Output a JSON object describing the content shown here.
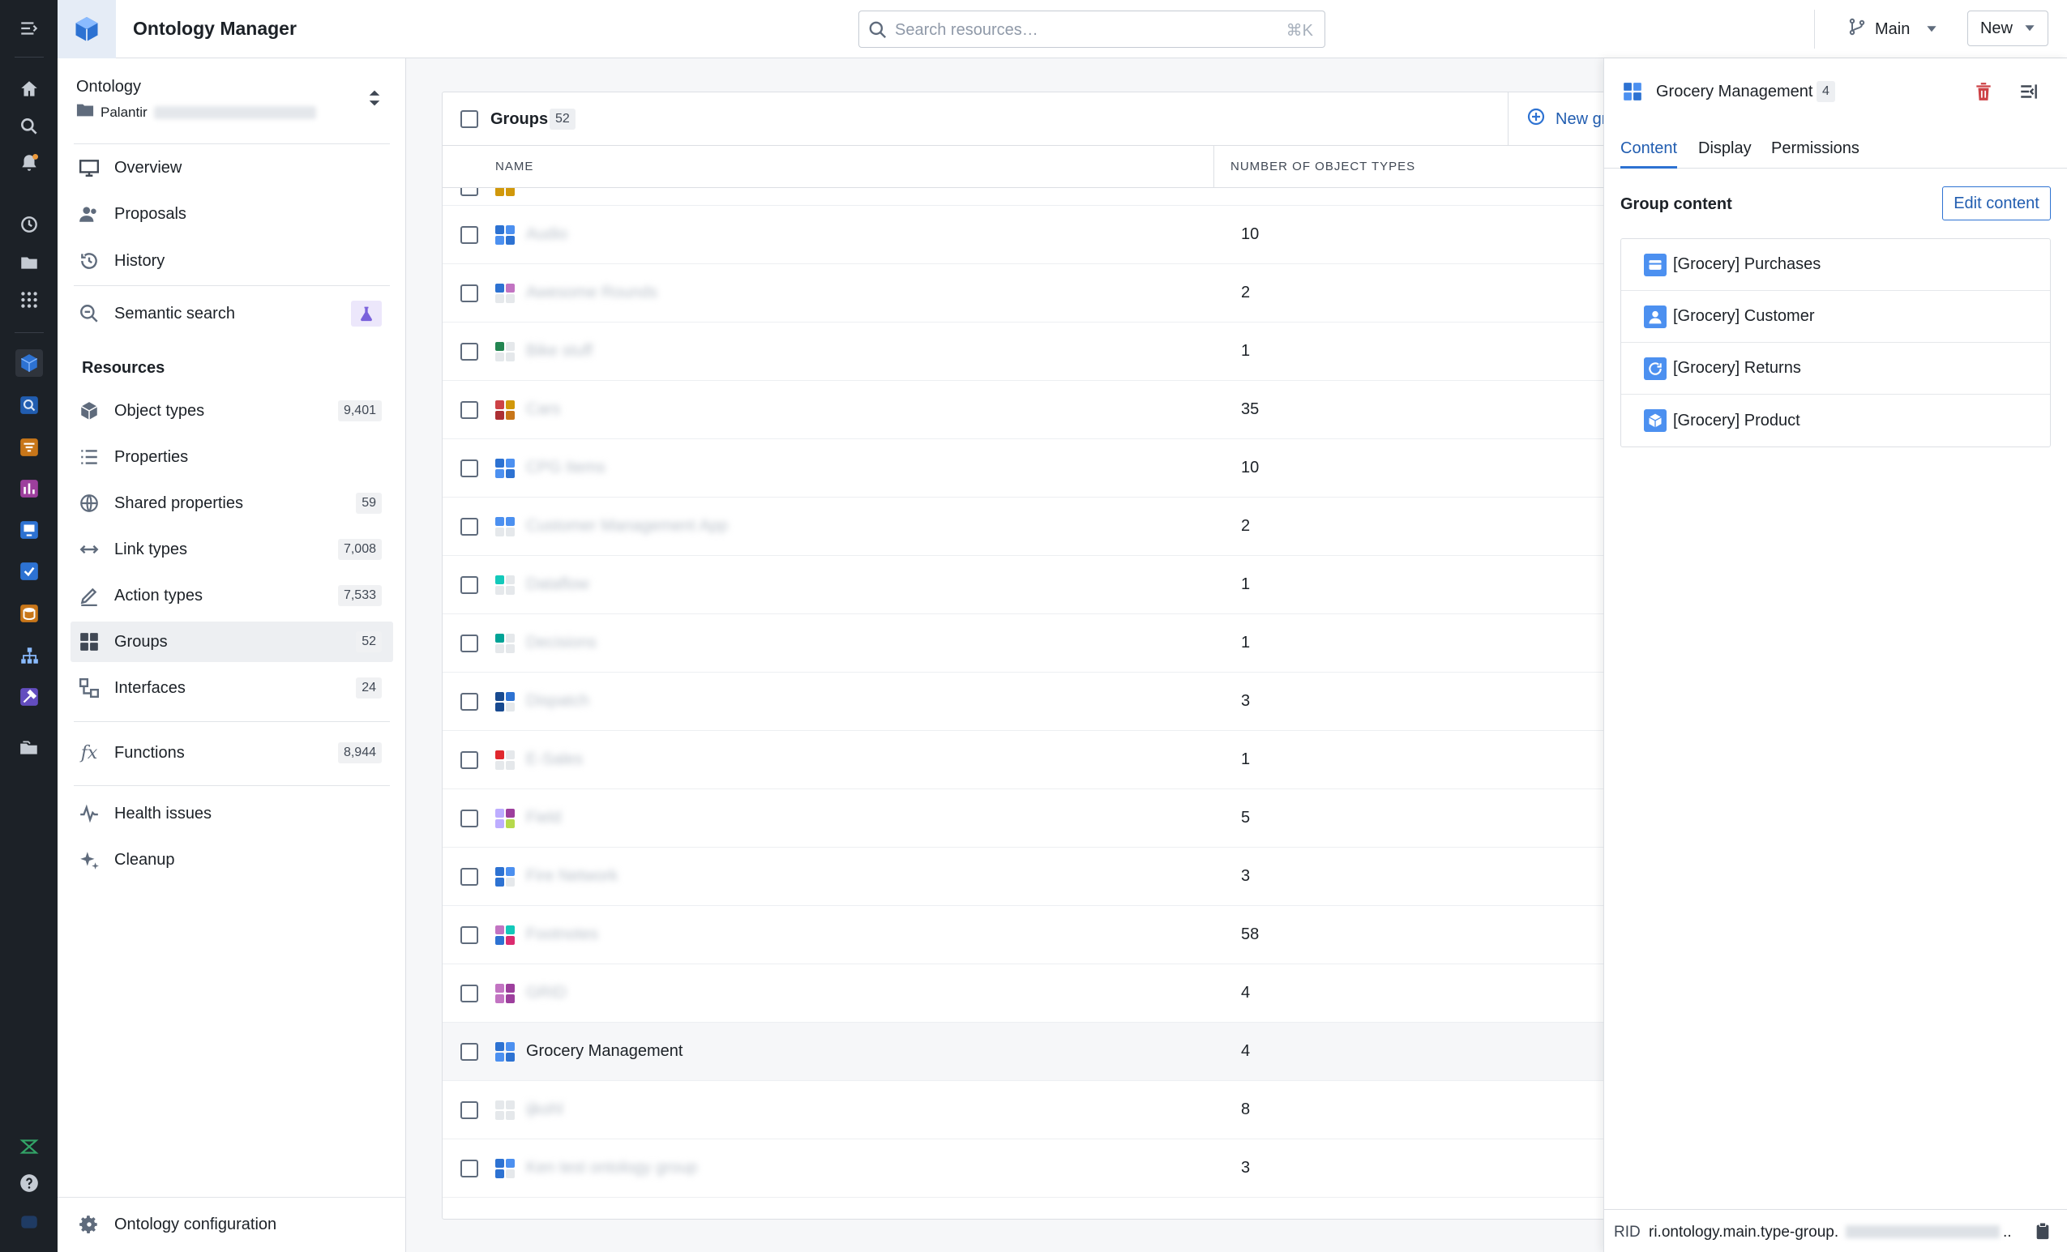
{
  "app": {
    "title": "Ontology Manager",
    "accent_color": "#2d72d2"
  },
  "search": {
    "placeholder": "Search resources…",
    "shortcut": "⌘K"
  },
  "header": {
    "branch_label": "Main",
    "new_label": "New"
  },
  "sidebar": {
    "ontology_label": "Ontology",
    "ontology_name": "Palantir",
    "nav_top": [
      {
        "label": "Overview",
        "icon": "monitor-icon"
      },
      {
        "label": "Proposals",
        "icon": "people-icon"
      },
      {
        "label": "History",
        "icon": "history-icon"
      }
    ],
    "semantic_search": {
      "label": "Semantic search",
      "icon": "search-icon",
      "badge_icon": "flask-icon"
    },
    "resources_heading": "Resources",
    "resources": [
      {
        "label": "Object types",
        "count": "9,401",
        "icon": "cube-icon"
      },
      {
        "label": "Properties",
        "count": "",
        "icon": "list-icon"
      },
      {
        "label": "Shared properties",
        "count": "59",
        "icon": "globe-icon"
      },
      {
        "label": "Link types",
        "count": "7,008",
        "icon": "arrows-icon"
      },
      {
        "label": "Action types",
        "count": "7,533",
        "icon": "edit-icon"
      },
      {
        "label": "Groups",
        "count": "52",
        "icon": "grid-icon"
      },
      {
        "label": "Interfaces",
        "count": "24",
        "icon": "interface-icon"
      }
    ],
    "functions": {
      "label": "Functions",
      "count": "8,944",
      "icon": "function-icon"
    },
    "extras": [
      {
        "label": "Health issues",
        "icon": "pulse-icon"
      },
      {
        "label": "Cleanup",
        "icon": "sparkle-icon"
      }
    ],
    "config_label": "Ontology configuration"
  },
  "table": {
    "title": "Groups",
    "count": "52",
    "new_group_label": "New gr",
    "columns": [
      "NAME",
      "NUMBER OF OBJECT TYPES"
    ],
    "rows": [
      {
        "name": "Audio",
        "count": "10",
        "colors": [
          "#2d72d2",
          "#4c90f0",
          "#4c90f0",
          "#2d72d2"
        ],
        "blurred": true
      },
      {
        "name": "Awesome Rounds",
        "count": "2",
        "colors": [
          "#2d72d2",
          "#c274c2",
          "#e5e8eb",
          "#e5e8eb"
        ],
        "blurred": true
      },
      {
        "name": "Bike stuff",
        "count": "1",
        "colors": [
          "#238551",
          "#e5e8eb",
          "#e5e8eb",
          "#e5e8eb"
        ],
        "blurred": true
      },
      {
        "name": "Cars",
        "count": "35",
        "colors": [
          "#cd4246",
          "#d1980b",
          "#ac2f33",
          "#c87619"
        ],
        "blurred": true
      },
      {
        "name": "CPG Items",
        "count": "10",
        "colors": [
          "#2d72d2",
          "#4c90f0",
          "#4c90f0",
          "#2d72d2"
        ],
        "blurred": true
      },
      {
        "name": "Customer Management App",
        "count": "2",
        "colors": [
          "#4c90f0",
          "#4c90f0",
          "#e5e8eb",
          "#e5e8eb"
        ],
        "blurred": true
      },
      {
        "name": "Dataflow",
        "count": "1",
        "colors": [
          "#13c9ba",
          "#e5e8eb",
          "#e5e8eb",
          "#e5e8eb"
        ],
        "blurred": true
      },
      {
        "name": "Decisions",
        "count": "1",
        "colors": [
          "#00a396",
          "#e5e8eb",
          "#e5e8eb",
          "#e5e8eb"
        ],
        "blurred": true
      },
      {
        "name": "Dispatch",
        "count": "3",
        "colors": [
          "#184a90",
          "#2d72d2",
          "#184a90",
          "#e5e8eb"
        ],
        "blurred": true
      },
      {
        "name": "E-Sales",
        "count": "1",
        "colors": [
          "#e0282e",
          "#e5e8eb",
          "#e5e8eb",
          "#e5e8eb"
        ],
        "blurred": true
      },
      {
        "name": "Field",
        "count": "5",
        "colors": [
          "#bdadff",
          "#9d3f9d",
          "#bdadff",
          "#b6d94c"
        ],
        "blurred": true
      },
      {
        "name": "Fire Network",
        "count": "3",
        "colors": [
          "#2d72d2",
          "#4c90f0",
          "#2d72d2",
          "#e5e8eb"
        ],
        "blurred": true
      },
      {
        "name": "Footnotes",
        "count": "58",
        "colors": [
          "#c274c2",
          "#13c9ba",
          "#2d72d2",
          "#db2c6f"
        ],
        "blurred": true
      },
      {
        "name": "GRID",
        "count": "4",
        "colors": [
          "#c274c2",
          "#9d3f9d",
          "#c274c2",
          "#9d3f9d"
        ],
        "blurred": true
      },
      {
        "name": "Grocery Management",
        "count": "4",
        "colors": [
          "#2d72d2",
          "#4c90f0",
          "#4c90f0",
          "#2d72d2"
        ],
        "blurred": false
      },
      {
        "name": "ijkohl",
        "count": "8",
        "colors": [
          "#e5e8eb",
          "#e5e8eb",
          "#e5e8eb",
          "#e5e8eb"
        ],
        "blurred": true
      },
      {
        "name": "Ken test ontology group",
        "count": "3",
        "colors": [
          "#2d72d2",
          "#4c90f0",
          "#2d72d2",
          "#e5e8eb"
        ],
        "blurred": true
      }
    ]
  },
  "panel": {
    "title": "Grocery Management",
    "count": "4",
    "tabs": [
      "Content",
      "Display",
      "Permissions"
    ],
    "content_heading": "Group content",
    "edit_label": "Edit content",
    "items": [
      {
        "label": "[Grocery] Purchases",
        "icon": "card-icon"
      },
      {
        "label": "[Grocery] Customer",
        "icon": "person-icon"
      },
      {
        "label": "[Grocery] Returns",
        "icon": "refresh-icon"
      },
      {
        "label": "[Grocery] Product",
        "icon": "cube-icon"
      }
    ],
    "rid_label": "RID",
    "rid_value": "ri.ontology.main.type-group.",
    "rid_ellipsis": ".."
  }
}
